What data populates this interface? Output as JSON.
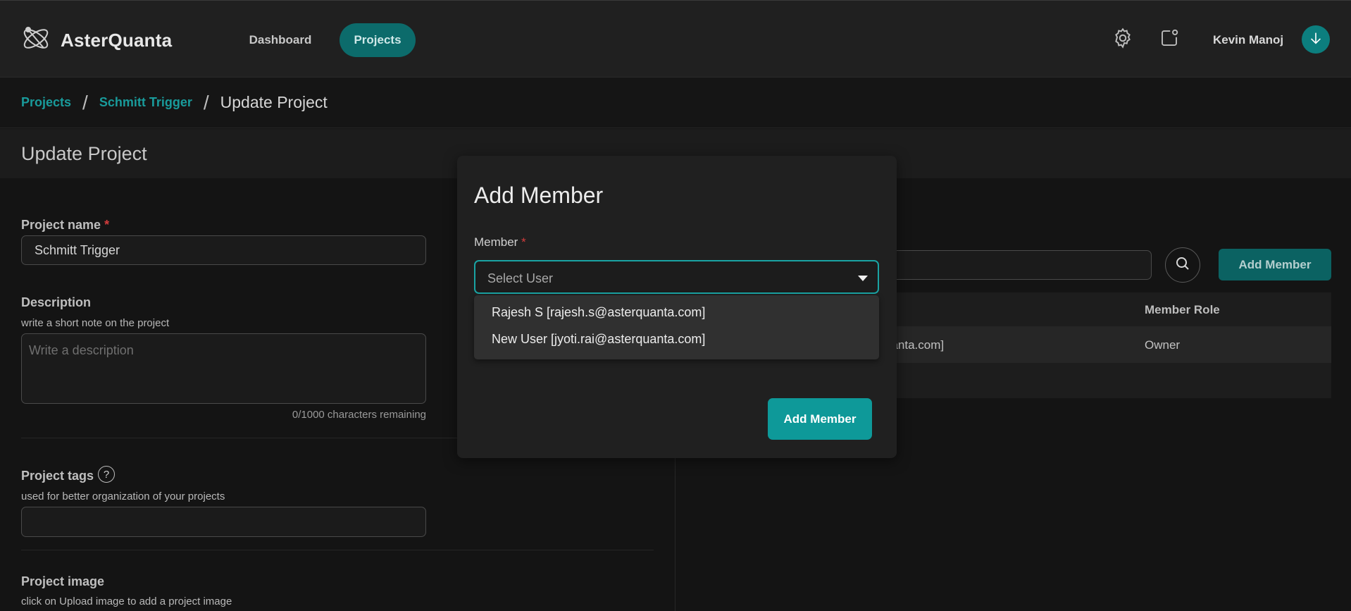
{
  "header": {
    "brand": "AsterQuanta",
    "nav": {
      "dashboard": "Dashboard",
      "projects": "Projects"
    },
    "user_name": "Kevin Manoj",
    "icons": {
      "settings": "gear-icon",
      "notifications": "notification-icon",
      "avatar": "arrow-down-icon"
    },
    "accent_color": "#0c6b6b"
  },
  "breadcrumb": {
    "items": [
      "Projects",
      "Schmitt Trigger"
    ],
    "current": "Update Project",
    "separator": "/"
  },
  "page_title": "Update Project",
  "form": {
    "project_name": {
      "label": "Project name",
      "required_mark": "*",
      "value": "Schmitt Trigger"
    },
    "description": {
      "label": "Description",
      "hint": "write a short note on the project",
      "placeholder": "Write a description",
      "counter": "0/1000 characters remaining"
    },
    "tags": {
      "label": "Project tags",
      "help_icon": "?",
      "hint": "used for better organization of your projects"
    },
    "image": {
      "label": "Project image",
      "hint": "click on Upload image to add a project image"
    }
  },
  "members_panel": {
    "add_button": "Add Member",
    "column_role": "Member Role",
    "rows": [
      {
        "email_fragment": "uanta.com]",
        "role": "Owner"
      }
    ]
  },
  "modal": {
    "title": "Add Member",
    "member_label": "Member",
    "required_mark": "*",
    "select_placeholder": "Select User",
    "options": [
      "Rajesh S [rajesh.s@asterquanta.com]",
      "New User [jyoti.rai@asterquanta.com]"
    ],
    "submit": "Add Member"
  }
}
